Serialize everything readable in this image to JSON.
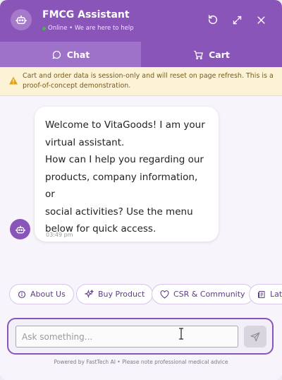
{
  "header": {
    "title": "FMCG Assistant",
    "status": "Online • We are here to help",
    "icons": [
      "bot-icon",
      "refresh-icon",
      "expand-icon",
      "close-icon"
    ]
  },
  "tabs": [
    {
      "label": "Chat",
      "icon": "chat-bubble-icon",
      "active": true
    },
    {
      "label": "Cart",
      "icon": "cart-icon",
      "active": false
    }
  ],
  "notice": {
    "icon": "warning-icon",
    "text": "Cart and order data is session-only and will reset on page refresh. This is a proof-of-concept demonstration."
  },
  "messages": [
    {
      "sender": "bot",
      "text": "Welcome to VitaGoods! I am your\nvirtual assistant.\nHow can I help you regarding our\nproducts, company information, or\nsocial activities? Use the menu\nbelow for quick access.",
      "time": "03:49 pm"
    }
  ],
  "quick_actions": [
    {
      "label": "About Us",
      "icon": "info-icon"
    },
    {
      "label": "Buy Product",
      "icon": "sparkle-icon"
    },
    {
      "label": "CSR & Community",
      "icon": "heart-icon"
    },
    {
      "label": "Late",
      "icon": "news-icon"
    }
  ],
  "input": {
    "placeholder": "Ask something...",
    "value": ""
  },
  "footer": "Powered by FastTech AI • Please note professional medical advice",
  "colors": {
    "brand": "#8a55b8",
    "notice_bg": "#fcf3d6",
    "status_online": "#4caf50"
  }
}
